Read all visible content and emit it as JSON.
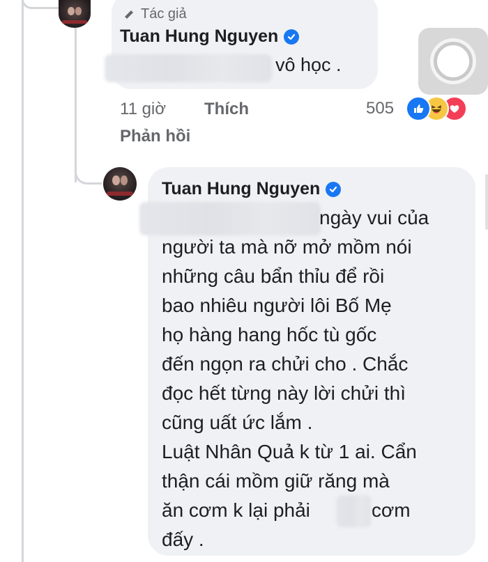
{
  "comment": {
    "author_badge": "Tác giả",
    "author_name": "Tuan Hung Nguyen",
    "text": "vô học .",
    "time": "11 giờ",
    "like_label": "Thích",
    "reply_label": "Phản hồi",
    "reaction_count": "505",
    "reactions": [
      "like-icon",
      "haha-icon",
      "love-icon"
    ]
  },
  "reply": {
    "author_name": "Tuan Hung Nguyen",
    "lines": [
      "ngày vui của",
      "người ta mà nỡ mở mồm nói",
      "những câu bẩn thỉu để rồi",
      "bao nhiêu người lôi Bố Mẹ",
      "họ hàng hang hốc tù gốc",
      "đến ngọn ra chửi cho . Chắc",
      "đọc hết từng này lời chửi thì",
      "cũng uất ức lắm .",
      "Luật Nhân Quả k từ 1 ai. Cẩn",
      "thận cái mồm giữ răng mà",
      "ăn cơm k lại phải",
      "đấy ."
    ],
    "last_line_tail": "cơm"
  },
  "colors": {
    "verified": "#1877f2",
    "bubble": "#eff1f4",
    "secondary_text": "#65676b",
    "love": "#f33e58",
    "haha": "#f7c744"
  }
}
